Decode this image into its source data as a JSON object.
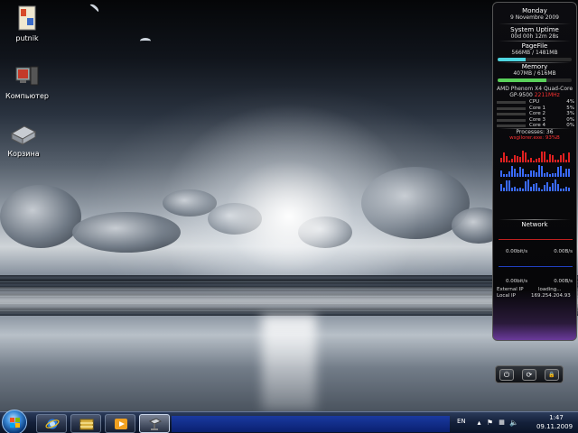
{
  "desktop": {
    "icons": [
      {
        "label": "putnik",
        "icon": "user-folder-icon"
      },
      {
        "label": "Компьютер",
        "icon": "computer-icon"
      },
      {
        "label": "Корзина",
        "icon": "recycle-bin-icon"
      }
    ]
  },
  "gadget": {
    "day": "Monday",
    "date": "9 Novembre 2009",
    "uptime_title": "System Uptime",
    "uptime_value": "00d 00h 12m 28s",
    "pagefile_title": "PageFile",
    "pagefile_value": "566MB / 1481MB",
    "pagefile_fraction": 0.38,
    "memory_title": "Memory",
    "memory_value": "407MB / 616MB",
    "memory_fraction": 0.66,
    "cpu_name": "AMD Phenom X4 Quad-Core",
    "cpu_model": "GP-9500",
    "cpu_freq": "2211MHz",
    "cpu_rows": [
      {
        "name": "CPU",
        "percent": "4%"
      },
      {
        "name": "Core 1",
        "percent": "5%"
      },
      {
        "name": "Core 2",
        "percent": "3%"
      },
      {
        "name": "Core 3",
        "percent": "0%"
      },
      {
        "name": "Core 4",
        "percent": "0%"
      }
    ],
    "processes": "Processes: 36",
    "top_process": "wsgilorer.exe: 93%B",
    "network_title": "Network",
    "download_left": "0.00bit/s",
    "download_right": "0.00B/s",
    "upload_left": "0.00bit/s",
    "upload_right": "0.00B/s",
    "external_ip_label": "External IP",
    "external_ip_value": "loading...",
    "local_ip_label": "Local IP",
    "local_ip_value": "169.254.204.93",
    "colors": {
      "pagefile": "#4fd6e0",
      "memory": "#5ad05a",
      "freq": "#ff3030",
      "spark_red": "#e02020",
      "spark_blue": "#3a6aff"
    }
  },
  "gadget_controls": [
    {
      "icon": "power-icon",
      "glyph": "⏻"
    },
    {
      "icon": "restart-icon",
      "glyph": "⟳"
    },
    {
      "icon": "lock-icon",
      "glyph": "🔒"
    }
  ],
  "taskbar": {
    "pinned": [
      {
        "icon": "internet-explorer-icon",
        "active": false
      },
      {
        "icon": "file-explorer-icon",
        "active": false
      },
      {
        "icon": "media-player-icon",
        "active": false
      },
      {
        "icon": "computer-tool-icon",
        "active": true
      }
    ],
    "language": "EN",
    "time": "1:47",
    "date": "09.11.2009"
  }
}
